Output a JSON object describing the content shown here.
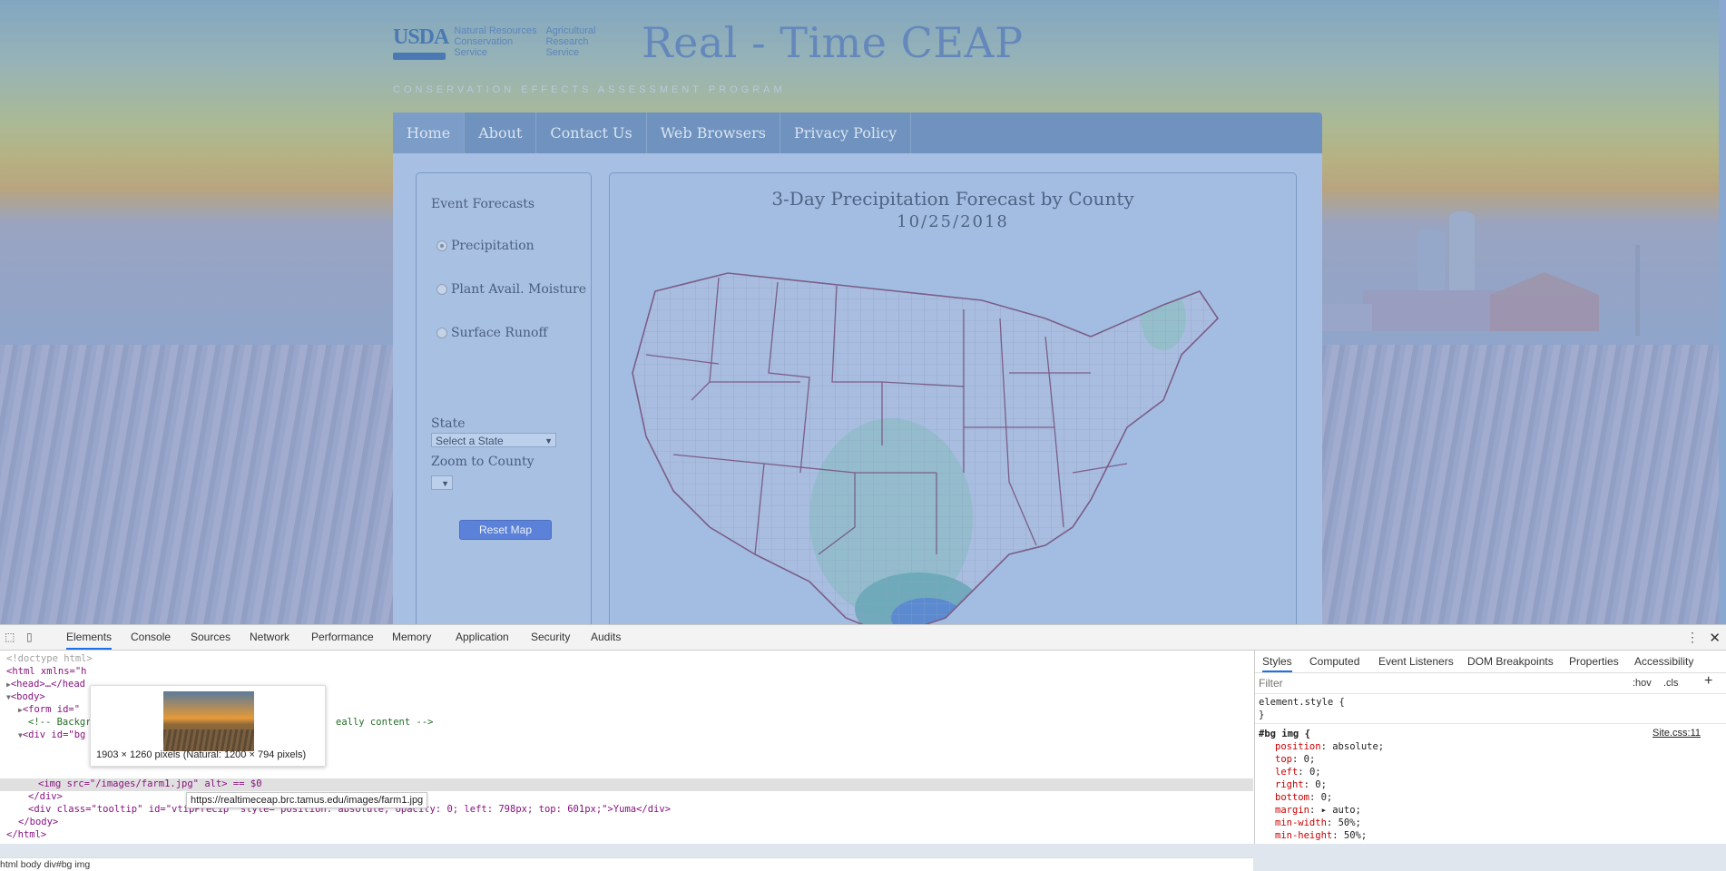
{
  "page": {
    "logo": {
      "agency": "USDA",
      "col1": [
        "Natural Resources",
        "Conservation",
        "Service"
      ],
      "col2": [
        "Agricultural",
        "Research",
        "Service"
      ]
    },
    "title": "Real - Time CEAP",
    "tagline": "CONSERVATION EFFECTS ASSESSMENT PROGRAM",
    "nav": [
      "Home",
      "About",
      "Contact Us",
      "Web Browsers",
      "Privacy Policy"
    ],
    "sidebar": {
      "heading": "Event Forecasts",
      "options": [
        {
          "label": "Precipitation",
          "selected": true
        },
        {
          "label": "Plant Avail. Moisture",
          "selected": false
        },
        {
          "label": "Surface Runoff",
          "selected": false
        }
      ],
      "state_label": "State",
      "state_value": "Select a State",
      "zoom_label": "Zoom to County",
      "zoom_value": "",
      "reset_button": "Reset Map"
    },
    "map": {
      "title": "3-Day Precipitation Forecast by County",
      "date": "10/25/2018"
    }
  },
  "devtools": {
    "tabs": [
      "Elements",
      "Console",
      "Sources",
      "Network",
      "Performance",
      "Memory",
      "Application",
      "Security",
      "Audits"
    ],
    "active_tab": "Elements",
    "dom_lines": [
      "<!doctype html>",
      "<html xmlns=\"h",
      "<head>…</head",
      "<body>",
      "<form id=\"",
      "<!-- Backgr",
      "eally content -->",
      "<div id=\"bg",
      "<img src=\"/images/farm1.jpg\" alt> == $0",
      "</div>",
      "<div class=\"tooltip\" id=\"vtipPrecip\" style=\"position: absolute; opacity: 0; left: 798px; top: 601px;\">Yuma</div>",
      "</body>",
      "</html>"
    ],
    "image_tooltip": "1903 × 1260 pixels (Natural: 1200 × 794 pixels)",
    "url_tooltip": "https://realtimeceap.brc.tamus.edu/images/farm1.jpg",
    "breadcrumb": "html  body  div#bg  img",
    "styles_tabs": [
      "Styles",
      "Computed",
      "Event Listeners",
      "DOM Breakpoints",
      "Properties",
      "Accessibility"
    ],
    "filter_placeholder": "Filter",
    "hov": ":hov",
    "cls": ".cls",
    "plus": "+",
    "element_style": "element.style {",
    "close_brace": "}",
    "rule_selector": "#bg img {",
    "rule_source": "Site.css:11",
    "rule_props": [
      {
        "name": "position",
        "value": "absolute;"
      },
      {
        "name": "top",
        "value": "0;"
      },
      {
        "name": "left",
        "value": "0;"
      },
      {
        "name": "right",
        "value": "0;"
      },
      {
        "name": "bottom",
        "value": "0;"
      },
      {
        "name": "margin",
        "value": "▸ auto;"
      },
      {
        "name": "min-width",
        "value": "50%;"
      },
      {
        "name": "min-height",
        "value": "50%;"
      }
    ]
  }
}
